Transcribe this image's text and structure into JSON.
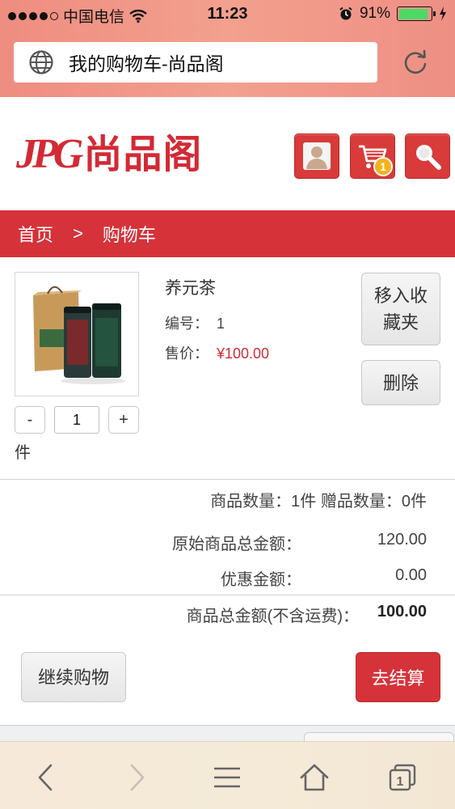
{
  "status_bar": {
    "carrier": "中国电信",
    "time": "11:23",
    "battery_percent": "91%"
  },
  "browser": {
    "page_title": "我的购物车-尚品阁"
  },
  "header": {
    "logo_mark": "JPG",
    "logo_text": "尚品阁",
    "cart_count": "1"
  },
  "breadcrumb": {
    "home": "首页",
    "separator": ">",
    "current": "购物车"
  },
  "cart_item": {
    "name": "养元茶",
    "sku_label": "编号：",
    "sku_value": "1",
    "price_label": "售价：",
    "price_value": "¥100.00",
    "move_to_favorites_label": "移入收藏夹",
    "delete_label": "删除",
    "minus_label": "-",
    "plus_label": "+",
    "quantity": "1",
    "unit": "件"
  },
  "summary": {
    "counts_text": "商品数量：1件 赠品数量：0件",
    "original_total_label": "原始商品总金额：",
    "original_total_value": "120.00",
    "discount_label": "优惠金额：",
    "discount_value": "0.00",
    "grand_total_label": "商品总金额(不含运费)：",
    "grand_total_value": "100.00"
  },
  "actions": {
    "continue_shopping_label": "继续购物",
    "checkout_label": "去结算"
  },
  "toolbar": {
    "tabs_count": "1"
  },
  "colors": {
    "brand_red": "#d5323a",
    "price_red": "#d32a35",
    "chrome_salmon": "#f3a08e",
    "badge_orange": "#f6b21b"
  },
  "icons": [
    "globe-icon",
    "reload-icon",
    "user-icon",
    "cart-icon",
    "search-icon",
    "back-icon",
    "forward-icon",
    "bookmarks-icon",
    "home-icon",
    "tabs-icon",
    "wifi-icon",
    "alarm-icon",
    "battery-icon"
  ]
}
